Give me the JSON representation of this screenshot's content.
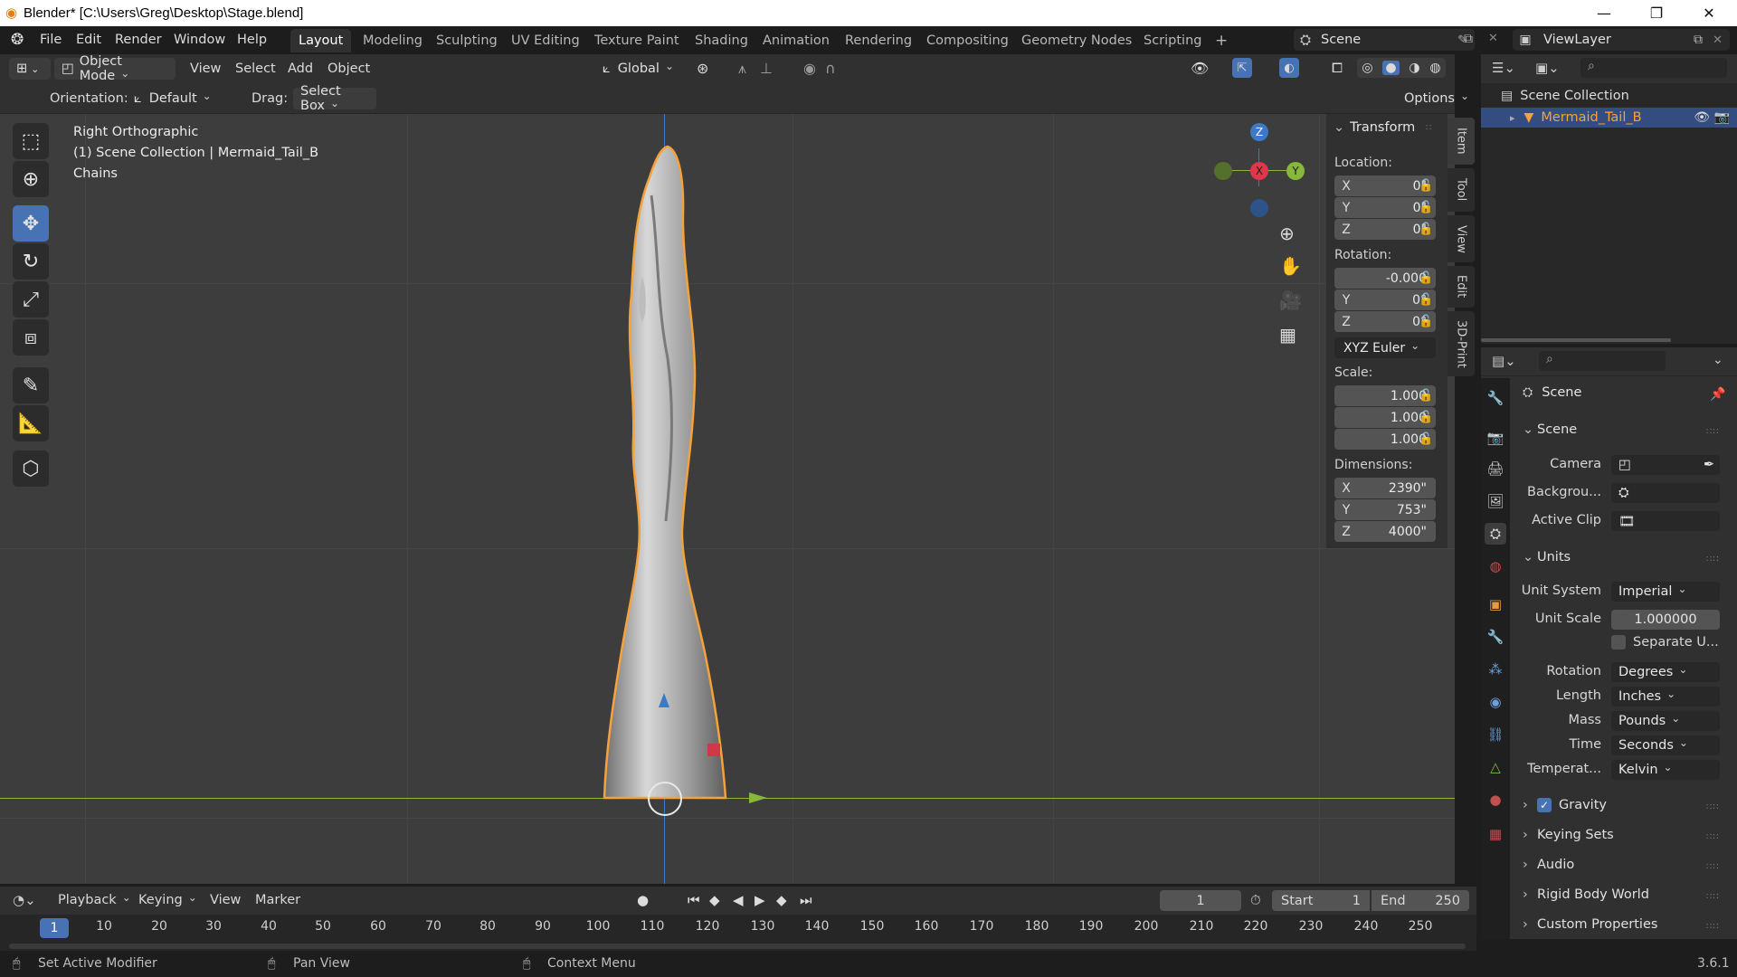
{
  "window": {
    "title": "Blender* [C:\\Users\\Greg\\Desktop\\Stage.blend]",
    "min": "—",
    "max": "❐",
    "close": "✕"
  },
  "topbar": {
    "menus": [
      "File",
      "Edit",
      "Render",
      "Window",
      "Help"
    ],
    "workspaces": [
      "Layout",
      "Modeling",
      "Sculpting",
      "UV Editing",
      "Texture Paint",
      "Shading",
      "Animation",
      "Rendering",
      "Compositing",
      "Geometry Nodes",
      "Scripting",
      "+"
    ],
    "active_workspace": "Layout",
    "scene": "Scene",
    "view_layer": "ViewLayer"
  },
  "viewport_header": {
    "mode": "Object Mode",
    "menus": [
      "View",
      "Select",
      "Add",
      "Object"
    ],
    "transform_orientation": "Global"
  },
  "tool_header": {
    "orientation_label": "Orientation:",
    "orientation_value": "Default",
    "drag_label": "Drag:",
    "drag_value": "Select Box",
    "options": "Options"
  },
  "viewport": {
    "view_name": "Right Orthographic",
    "collection_info": "(1) Scene Collection | Mermaid_Tail_B",
    "modifier_name": "Chains",
    "gizmo": {
      "z": "Z",
      "x": "X",
      "y": "Y"
    }
  },
  "npanel": {
    "section": "Transform",
    "location_label": "Location:",
    "location": [
      {
        "axis": "X",
        "value": "0\""
      },
      {
        "axis": "Y",
        "value": "0\""
      },
      {
        "axis": "Z",
        "value": "0\""
      }
    ],
    "rotation_label": "Rotation:",
    "rotation": [
      {
        "axis": "",
        "value": "-0.000"
      },
      {
        "axis": "Y",
        "value": "0°"
      },
      {
        "axis": "Z",
        "value": "0°"
      }
    ],
    "rotation_mode": "XYZ Euler",
    "scale_label": "Scale:",
    "scale": [
      "1.000",
      "1.000",
      "1.000"
    ],
    "dimensions_label": "Dimensions:",
    "dimensions": [
      {
        "axis": "X",
        "value": "2390\""
      },
      {
        "axis": "Y",
        "value": "753\""
      },
      {
        "axis": "Z",
        "value": "4000\""
      }
    ],
    "tabs": [
      "Item",
      "Tool",
      "View",
      "Edit",
      "3D-Print"
    ]
  },
  "outliner": {
    "root": "Scene Collection",
    "items": [
      {
        "name": "Mermaid_Tail_B"
      }
    ]
  },
  "properties": {
    "header": "Scene",
    "scene_section": "Scene",
    "camera_label": "Camera",
    "background_label": "Backgrou...",
    "active_clip_label": "Active Clip",
    "units_section": "Units",
    "unit_system_label": "Unit System",
    "unit_system": "Imperial",
    "unit_scale_label": "Unit Scale",
    "unit_scale": "1.000000",
    "separate_units": "Separate U...",
    "rotation_label": "Rotation",
    "rotation": "Degrees",
    "length_label": "Length",
    "length": "Inches",
    "mass_label": "Mass",
    "mass": "Pounds",
    "time_label": "Time",
    "time": "Seconds",
    "temperature_label": "Temperat...",
    "temperature": "Kelvin",
    "gravity": "Gravity",
    "collapsed": [
      "Keying Sets",
      "Audio",
      "Rigid Body World",
      "Custom Properties"
    ]
  },
  "timeline": {
    "menus": [
      "Playback",
      "Keying",
      "View",
      "Marker"
    ],
    "current_frame": "1",
    "start_label": "Start",
    "start": "1",
    "end_label": "End",
    "end": "250",
    "ticks": [
      "10",
      "20",
      "30",
      "40",
      "50",
      "60",
      "70",
      "80",
      "90",
      "100",
      "110",
      "120",
      "130",
      "140",
      "150",
      "160",
      "170",
      "180",
      "190",
      "200",
      "210",
      "220",
      "230",
      "240",
      "250"
    ]
  },
  "status": {
    "left": "Set Active Modifier",
    "middle": "Pan View",
    "right": "Context Menu",
    "version": "3.6.1"
  },
  "colors": {
    "accent": "#4772b3",
    "selected_outline": "#f5a23a",
    "x_axis": "#e0374a",
    "y_axis": "#8bc34a",
    "z_axis": "#3d7cd1"
  }
}
